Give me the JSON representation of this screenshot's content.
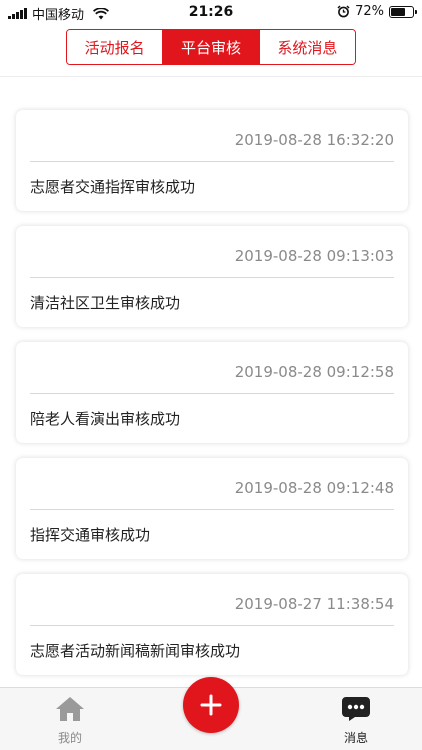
{
  "status_bar": {
    "carrier": "中国移动",
    "time": "21:26",
    "battery_percent": "72%",
    "battery_level": 0.72
  },
  "tabs": [
    {
      "label": "活动报名",
      "active": false
    },
    {
      "label": "平台审核",
      "active": true
    },
    {
      "label": "系统消息",
      "active": false
    }
  ],
  "messages": [
    {
      "time": "2019-08-28 16:32:20",
      "title": "志愿者交通指挥审核成功"
    },
    {
      "time": "2019-08-28 09:13:03",
      "title": "清洁社区卫生审核成功"
    },
    {
      "time": "2019-08-28 09:12:58",
      "title": "陪老人看演出审核成功"
    },
    {
      "time": "2019-08-28 09:12:48",
      "title": "指挥交通审核成功"
    },
    {
      "time": "2019-08-27 11:38:54",
      "title": "志愿者活动新闻稿新闻审核成功"
    }
  ],
  "bottom_nav": {
    "mine_label": "我的",
    "messages_label": "消息",
    "add_icon": "plus-icon"
  },
  "colors": {
    "accent": "#e0161c",
    "muted_text": "#8a8a8a"
  }
}
